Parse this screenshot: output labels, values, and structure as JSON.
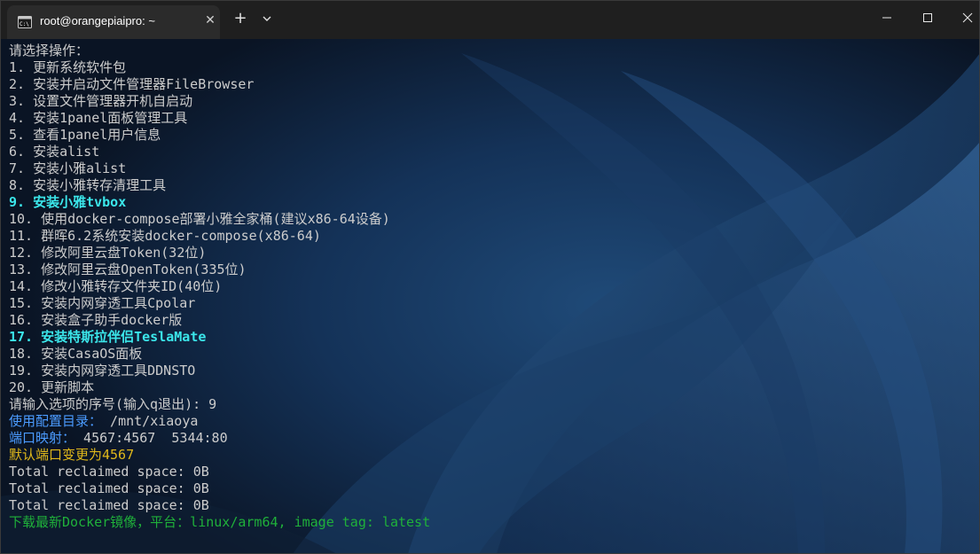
{
  "window": {
    "tab_title": "root@orangepiaipro: ~",
    "tab_close_glyph": "✕",
    "new_tab_glyph": "+"
  },
  "colors": {
    "default_text": "#cccccc",
    "cyan_highlight": "#3be6ea",
    "blue_label": "#4b9bff",
    "yellow_notice": "#e0b81b",
    "green_status": "#1fb03a",
    "titlebar": "#1f1f1f",
    "tab": "#2b2b2b"
  },
  "terminal": {
    "lines": [
      {
        "text": "请选择操作：",
        "style": "default"
      },
      {
        "text": "1. 更新系统软件包",
        "style": "default"
      },
      {
        "text": "2. 安装并启动文件管理器FileBrowser",
        "style": "default"
      },
      {
        "text": "3. 设置文件管理器开机自启动",
        "style": "default"
      },
      {
        "text": "4. 安装1panel面板管理工具",
        "style": "default"
      },
      {
        "text": "5. 查看1panel用户信息",
        "style": "default"
      },
      {
        "text": "6. 安装alist",
        "style": "default"
      },
      {
        "text": "7. 安装小雅alist",
        "style": "default"
      },
      {
        "text": "8. 安装小雅转存清理工具",
        "style": "default"
      },
      {
        "text": "9. 安装小雅tvbox",
        "style": "cyan"
      },
      {
        "text": "10. 使用docker-compose部署小雅全家桶(建议x86-64设备)",
        "style": "default"
      },
      {
        "text": "11. 群晖6.2系统安装docker-compose(x86-64)",
        "style": "default"
      },
      {
        "text": "12. 修改阿里云盘Token(32位)",
        "style": "default"
      },
      {
        "text": "13. 修改阿里云盘OpenToken(335位)",
        "style": "default"
      },
      {
        "text": "14. 修改小雅转存文件夹ID(40位)",
        "style": "default"
      },
      {
        "text": "15. 安装内网穿透工具Cpolar",
        "style": "default"
      },
      {
        "text": "16. 安装盒子助手docker版",
        "style": "default"
      },
      {
        "text": "17. 安装特斯拉伴侣TeslaMate",
        "style": "cyan"
      },
      {
        "text": "18. 安装CasaOS面板",
        "style": "default"
      },
      {
        "text": "19. 安装内网穿透工具DDNSTO",
        "style": "default"
      },
      {
        "text": "20. 更新脚本",
        "style": "default"
      },
      {
        "text": "请输入选项的序号(输入q退出): 9",
        "style": "default"
      },
      {
        "segments": [
          {
            "text": "使用配置目录：",
            "style": "blue"
          },
          {
            "text": " /mnt/xiaoya",
            "style": "default"
          }
        ]
      },
      {
        "segments": [
          {
            "text": "端口映射：",
            "style": "blue"
          },
          {
            "text": " 4567:4567  5344:80",
            "style": "default"
          }
        ]
      },
      {
        "text": "默认端口变更为4567",
        "style": "yellow"
      },
      {
        "text": "Total reclaimed space: 0B",
        "style": "default"
      },
      {
        "text": "Total reclaimed space: 0B",
        "style": "default"
      },
      {
        "text": "Total reclaimed space: 0B",
        "style": "default"
      },
      {
        "text": "下载最新Docker镜像，平台：linux/arm64, image tag: latest",
        "style": "green"
      }
    ]
  }
}
